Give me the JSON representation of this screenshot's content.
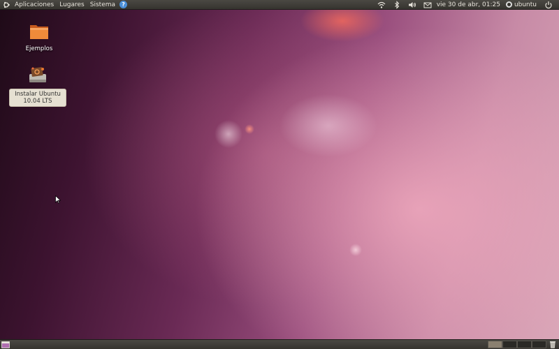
{
  "top_panel": {
    "menus": [
      {
        "label": "Aplicaciones"
      },
      {
        "label": "Lugares"
      },
      {
        "label": "Sistema"
      }
    ],
    "clock": "vie 30 de abr, 01:25",
    "user": "ubuntu",
    "icons": [
      "ubuntu-logo-icon",
      "help-icon",
      "wifi-icon",
      "bluetooth-icon",
      "volume-icon",
      "mail-icon",
      "user-icon",
      "power-icon"
    ]
  },
  "desktop": {
    "icons": [
      {
        "label": "Ejemplos",
        "icon": "folder-icon"
      },
      {
        "label": "Instalar Ubuntu 10.04 LTS",
        "icon": "installer-icon",
        "selected": true
      }
    ]
  },
  "bottom_panel": {
    "workspace_count": 4,
    "active_workspace": 1,
    "icons": [
      "show-desktop-icon",
      "trash-icon"
    ]
  },
  "colors": {
    "panel": "#3f3d38",
    "accent_orange": "#e9782f",
    "help_blue": "#4b8fd8"
  }
}
